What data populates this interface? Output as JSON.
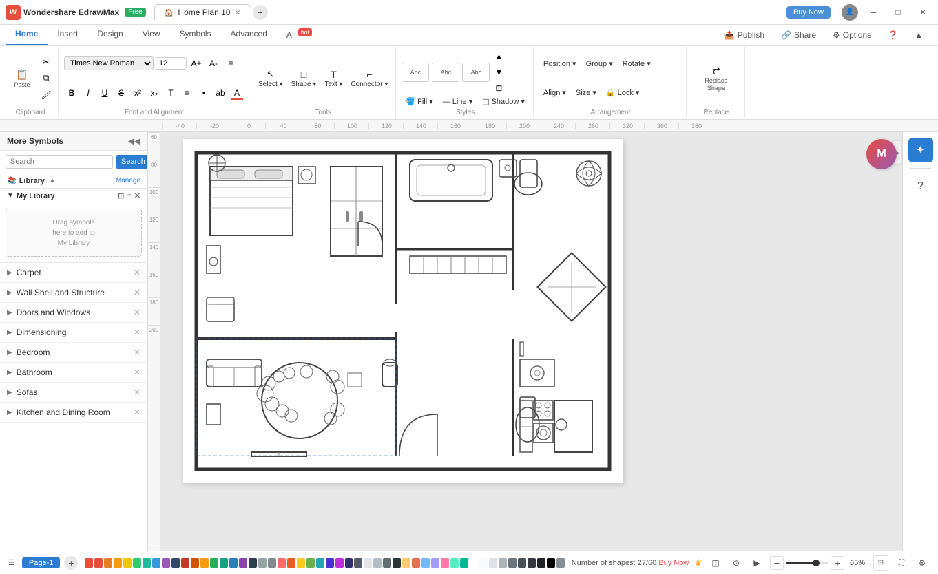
{
  "app": {
    "name": "Wondershare EdrawMax",
    "free_badge": "Free",
    "logo_letter": "W"
  },
  "tabs": [
    {
      "id": "home-plan",
      "label": "Home Plan 10",
      "active": true
    },
    {
      "id": "new-tab",
      "label": "+",
      "is_add": true
    }
  ],
  "win_controls": {
    "buy_now": "Buy Now",
    "minimize": "─",
    "restore": "□",
    "close": "✕"
  },
  "ribbon_tabs": [
    {
      "id": "home",
      "label": "Home",
      "active": true
    },
    {
      "id": "insert",
      "label": "Insert"
    },
    {
      "id": "design",
      "label": "Design"
    },
    {
      "id": "view",
      "label": "View"
    },
    {
      "id": "symbols",
      "label": "Symbols"
    },
    {
      "id": "advanced",
      "label": "Advanced"
    },
    {
      "id": "ai",
      "label": "AI",
      "badge": "hot"
    }
  ],
  "ribbon_publish": "Publish",
  "ribbon_share": "Share",
  "ribbon_options": "Options",
  "clipboard": {
    "label": "Clipboard",
    "paste": "Paste",
    "cut": "Cut",
    "copy": "Copy",
    "format_painter": "Format Painter"
  },
  "font": {
    "label": "Font and Alignment",
    "family": "Times New Roman",
    "size": "12",
    "bold": "B",
    "italic": "I",
    "underline": "U",
    "strike": "S",
    "superscript": "x²",
    "subscript": "x₂",
    "text_style": "T",
    "list": "≡",
    "bullet": "•",
    "ab": "ab",
    "color_a": "A",
    "increase": "A+",
    "decrease": "A-",
    "align": "≡"
  },
  "tools": {
    "label": "Tools",
    "select": "Select",
    "select_arrow": "~",
    "shape": "Shape",
    "text": "Text",
    "connector": "Connector"
  },
  "styles": {
    "label": "Styles",
    "fill": "Fill",
    "line": "Line",
    "shadow": "Shadow",
    "shapes": [
      "Abc",
      "Abc",
      "Abc"
    ]
  },
  "arrangement": {
    "label": "Arrangement",
    "position": "Position",
    "group": "Group",
    "rotate": "Rotate",
    "align": "Align",
    "size": "Size",
    "lock": "Lock"
  },
  "replace": {
    "label": "Replace",
    "replace_shape": "Replace Shape"
  },
  "sidebar": {
    "title": "More Symbols",
    "search_placeholder": "Search",
    "search_btn": "Search",
    "library_title": "Library",
    "manage_link": "Manage",
    "my_library": "My Library",
    "drop_text": "Drag symbols\nhere to add to\nMy Library",
    "categories": [
      {
        "id": "carpet",
        "label": "Carpet"
      },
      {
        "id": "wall-shell",
        "label": "Wall Shell and Structure"
      },
      {
        "id": "doors-windows",
        "label": "Doors and Windows"
      },
      {
        "id": "dimensioning",
        "label": "Dimensioning"
      },
      {
        "id": "bedroom",
        "label": "Bedroom"
      },
      {
        "id": "bathroom",
        "label": "Bathroom"
      },
      {
        "id": "sofas",
        "label": "Sofas"
      },
      {
        "id": "kitchen",
        "label": "Kitchen and Dining Room"
      }
    ]
  },
  "statusbar": {
    "page_label": "Page-1",
    "shapes_label": "Number of shapes: 27/60",
    "buy_now": "Buy Now",
    "zoom_pct": "65%",
    "fit_btn": "⊡",
    "expand_btn": "⛶"
  },
  "ruler": {
    "h_marks": [
      "-40",
      "-20",
      "0",
      "40",
      "80",
      "120",
      "140",
      "140",
      "180",
      "200",
      "240",
      "280",
      "320",
      "360",
      "380"
    ],
    "v_marks": [
      "60",
      "80",
      "100",
      "120",
      "140",
      "160",
      "180",
      "200"
    ]
  },
  "colors": [
    "#e84c3d",
    "#e74c3c",
    "#e67e22",
    "#f39c12",
    "#f1c40f",
    "#2ecc71",
    "#1abc9c",
    "#3498db",
    "#9b59b6",
    "#34495e",
    "#c0392b",
    "#d35400",
    "#f39c12",
    "#27ae60",
    "#16a085",
    "#2980b9",
    "#8e44ad",
    "#2c3e50",
    "#95a5a6",
    "#7f8c8d",
    "#ff6b6b",
    "#ee5a24",
    "#f9ca24",
    "#6ab04c",
    "#22a6b3",
    "#4834d4",
    "#be2edd",
    "#30336b",
    "#535c68",
    "#dfe6e9",
    "#b2bec3",
    "#636e72",
    "#2d3436",
    "#fdcb6e",
    "#e17055",
    "#74b9ff",
    "#a29bfe",
    "#fd79a8",
    "#55efc4",
    "#00b894",
    "#ffffff",
    "#f8f9fa",
    "#dee2e6",
    "#adb5bd",
    "#6c757d",
    "#495057",
    "#343a40",
    "#212529",
    "#000000",
    "#868e96"
  ]
}
